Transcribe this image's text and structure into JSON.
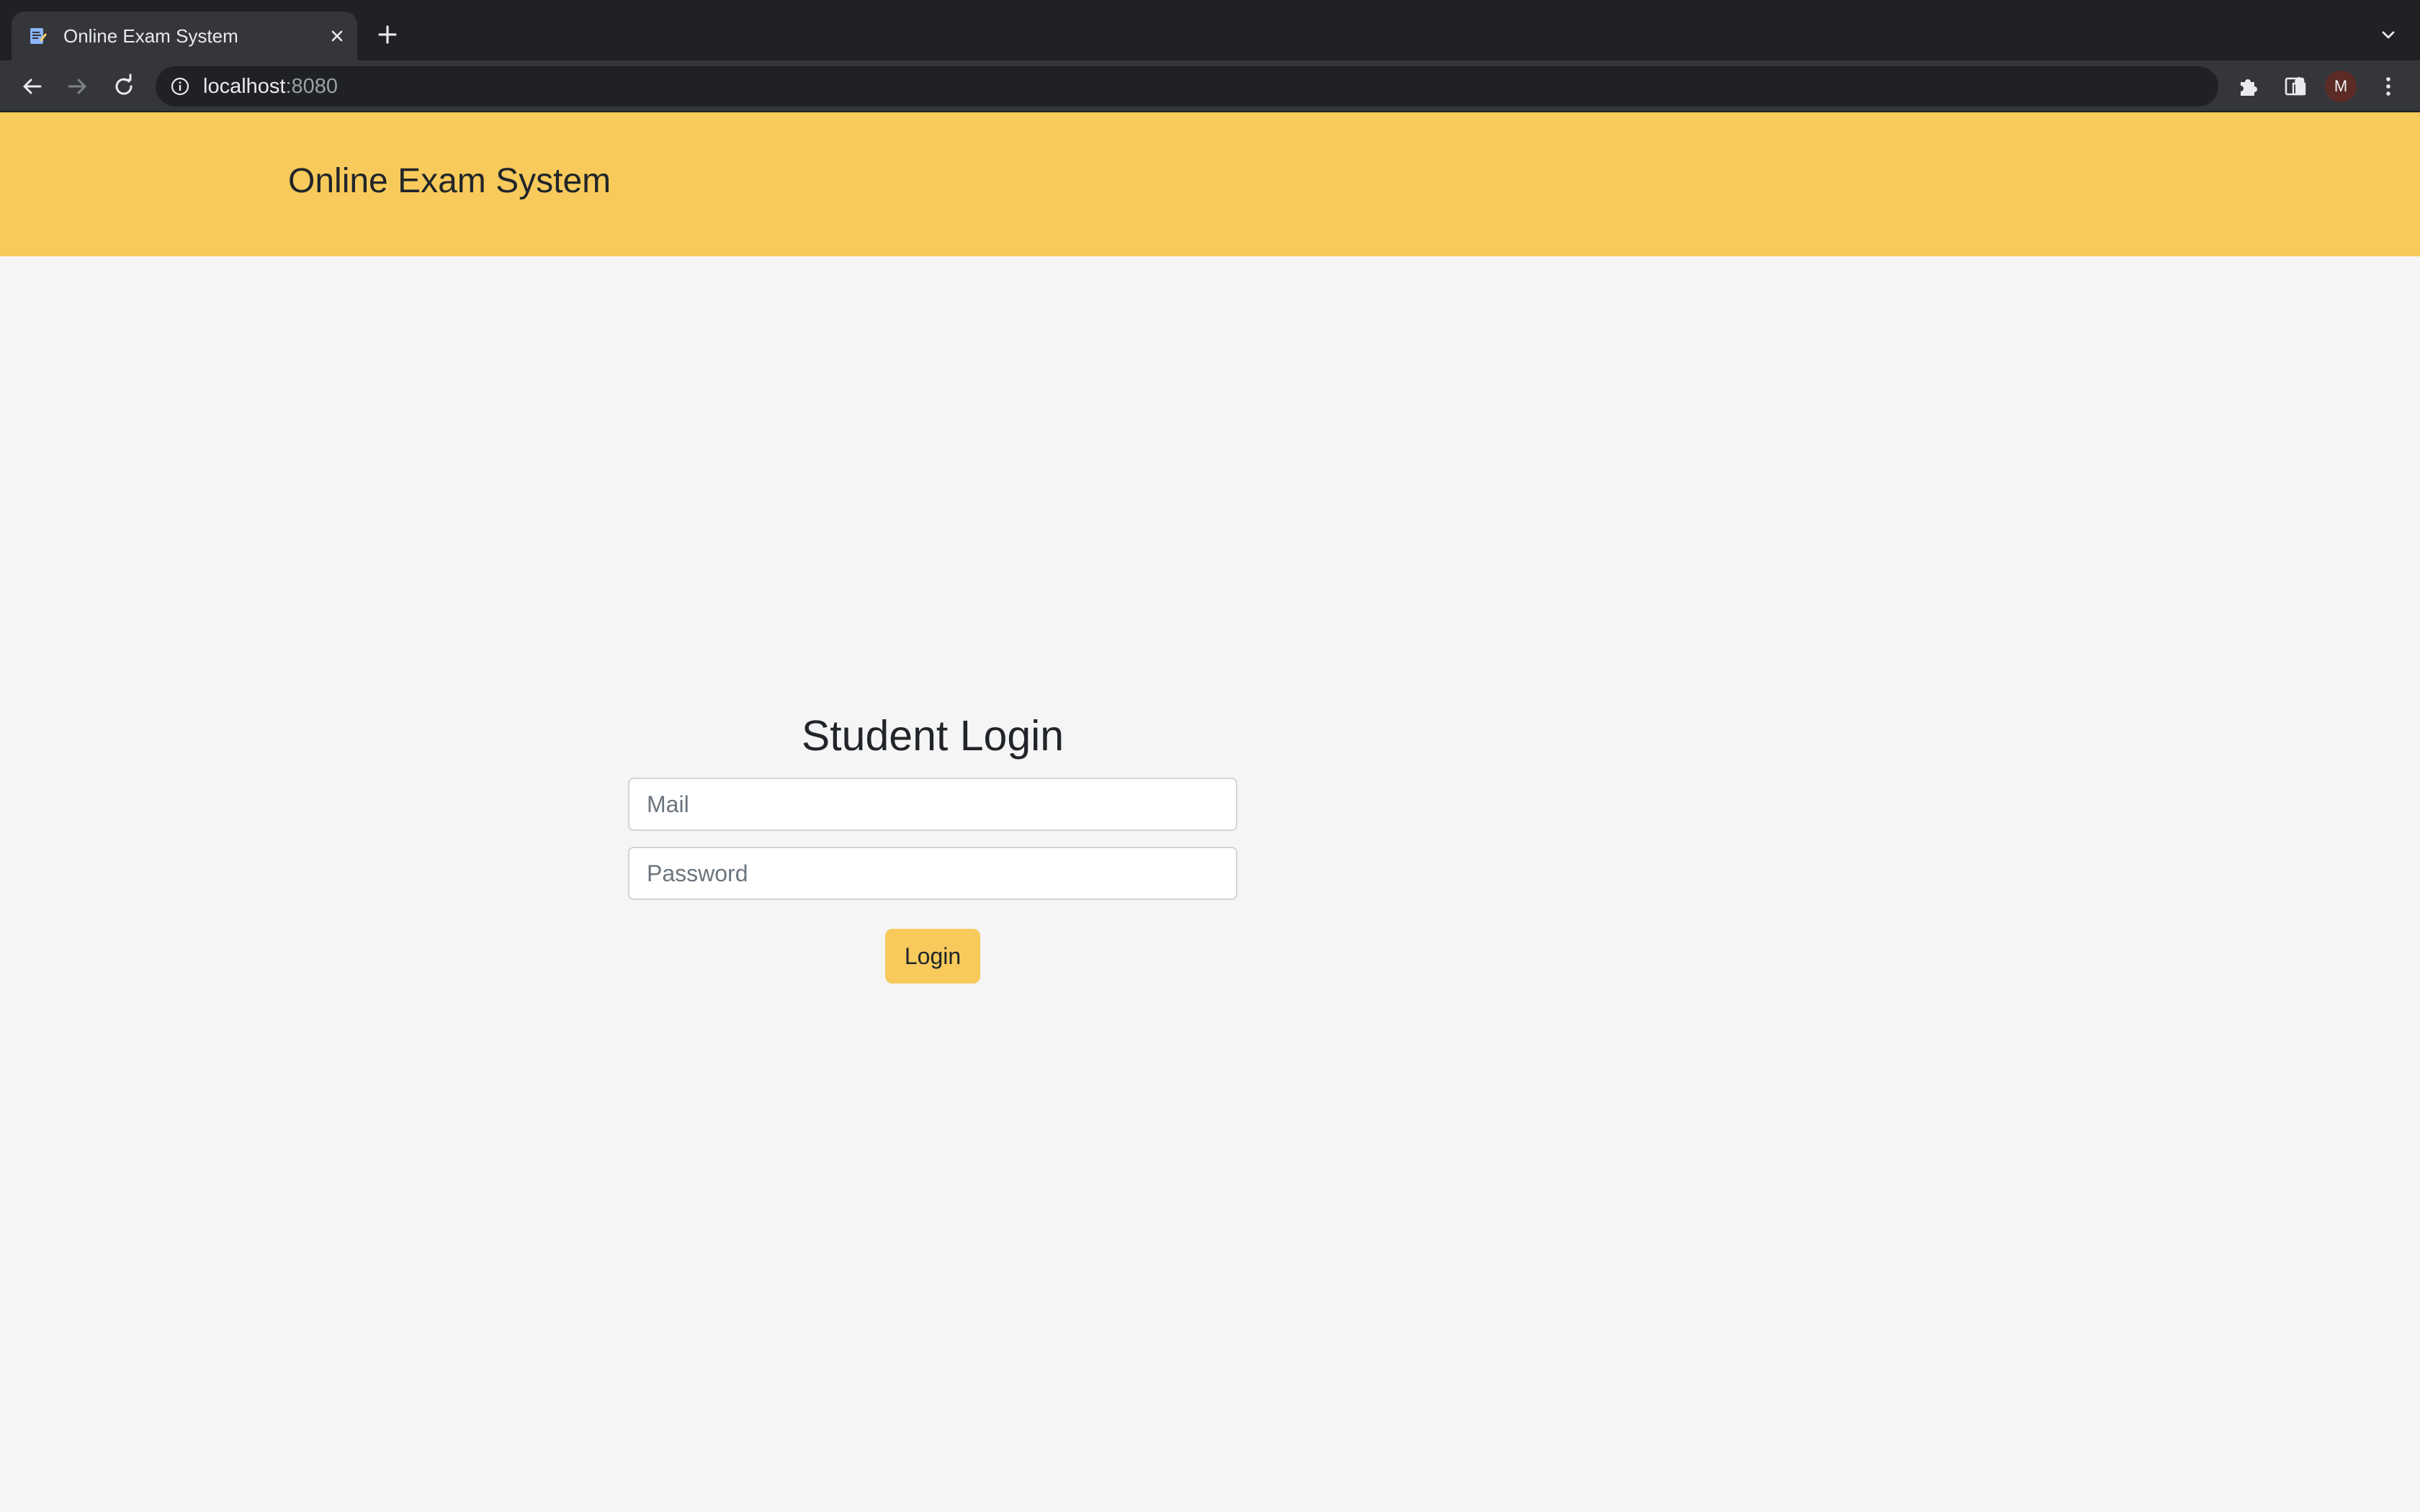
{
  "browser": {
    "tab": {
      "title": "Online Exam System",
      "favicon": "exam-sheet-icon"
    },
    "url": {
      "host": "localhost",
      "port": ":8080"
    },
    "profile_initial": "M",
    "icons": [
      "back-icon",
      "forward-icon",
      "reload-icon",
      "info-icon",
      "share-icon",
      "star-icon",
      "extensions-icon",
      "side-panel-icon",
      "menu-icon",
      "tab-search-icon",
      "new-tab-icon",
      "close-icon"
    ]
  },
  "header": {
    "brand": "Online Exam System"
  },
  "login": {
    "title": "Student Login",
    "mail_placeholder": "Mail",
    "mail_value": "",
    "password_placeholder": "Password",
    "password_value": "",
    "button_label": "Login"
  },
  "colors": {
    "accent": "#f7ca5b",
    "page_background": "#f5f5f5",
    "chrome_dark": "#202124",
    "chrome_toolbar": "#35363a",
    "avatar": "#5c2b26"
  }
}
